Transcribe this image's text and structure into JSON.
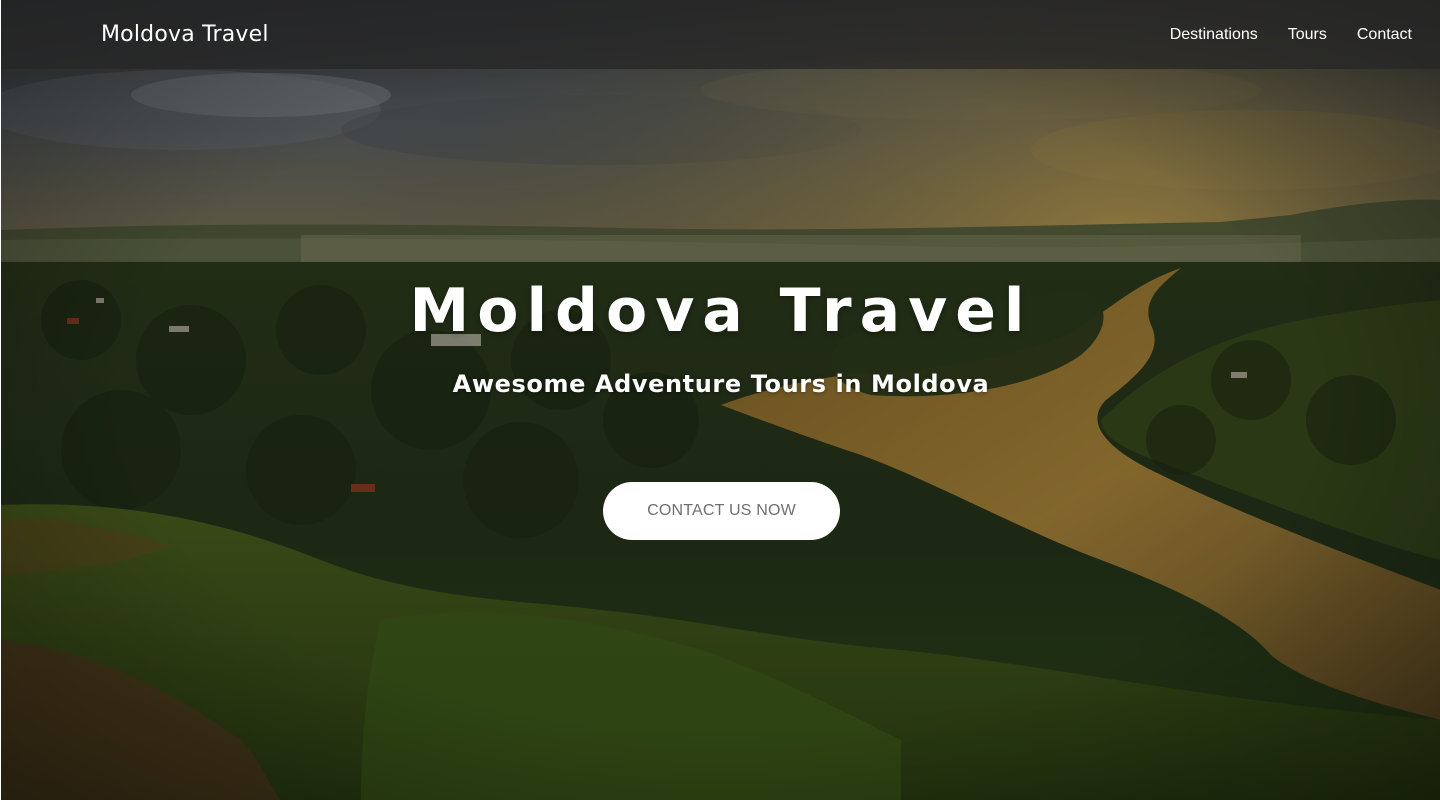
{
  "navbar": {
    "brand": "Moldova Travel",
    "links": [
      {
        "label": "Destinations"
      },
      {
        "label": "Tours"
      },
      {
        "label": "Contact"
      }
    ]
  },
  "hero": {
    "title": "Moldova Travel",
    "subtitle": "Awesome Adventure Tours in Moldova",
    "cta_label": "CONTACT US NOW"
  },
  "colors": {
    "navbar_bg": "#262626",
    "text_light": "#ffffff",
    "cta_bg": "#ffffff",
    "cta_text": "#6f6f6f"
  }
}
